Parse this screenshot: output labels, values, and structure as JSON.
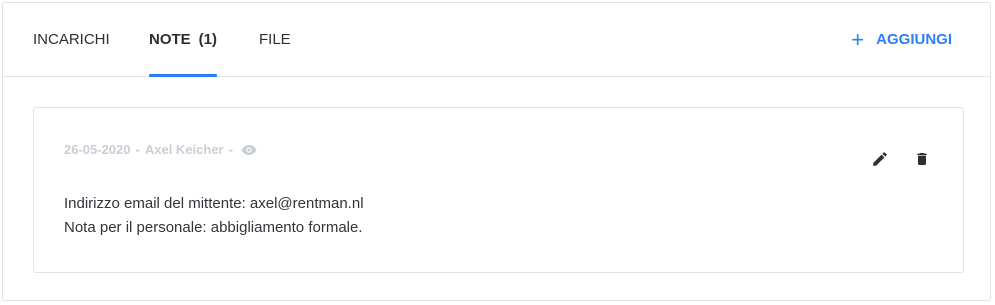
{
  "tabs": [
    {
      "label": "INCARICHI",
      "count": "",
      "active": false
    },
    {
      "label": "NOTE",
      "count": "(1)",
      "active": true
    },
    {
      "label": "FILE",
      "count": "",
      "active": false
    }
  ],
  "actions": {
    "add_label": "AGGIUNGI",
    "add_icon": "plus-icon"
  },
  "note": {
    "date": "26-05-2020",
    "author": "Axel Keicher",
    "separator": "-",
    "visibility_icon": "eye-icon",
    "edit_icon": "pencil-icon",
    "delete_icon": "trash-icon",
    "lines": [
      "Indirizzo email del mittente: axel@rentman.nl",
      "Nota per il personale: abbigliamento formale."
    ]
  },
  "colors": {
    "accent": "#2d7ff9",
    "meta_text": "#c9ced4",
    "border": "#e0e4e8"
  }
}
